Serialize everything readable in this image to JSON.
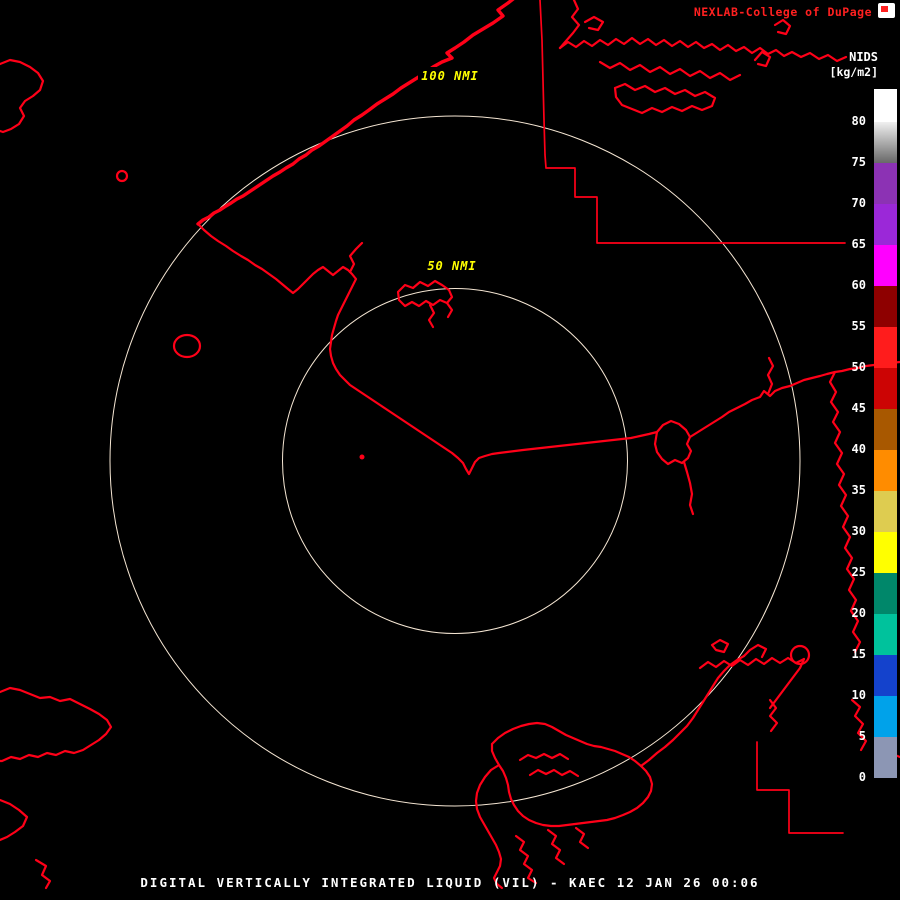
{
  "header": {
    "brand": "NEXLAB-College of DuPage"
  },
  "colors": {
    "background": "#000000",
    "brand": "#ff2020",
    "text": "#ffffff",
    "map_outline": "#ff0018",
    "range_ring": "#f6e7d4",
    "ring_label": "#ffff00"
  },
  "rings": [
    {
      "label": "100 NMI",
      "radius_nmi": 100
    },
    {
      "label": "50 NMI",
      "radius_nmi": 50
    }
  ],
  "colorbar": {
    "title": "NIDS",
    "units": "[kg/m2]",
    "ticks": [
      80,
      75,
      70,
      65,
      60,
      55,
      50,
      45,
      40,
      35,
      30,
      25,
      20,
      15,
      10,
      5,
      0
    ],
    "segments": [
      {
        "from": 80,
        "to": 84,
        "color": "#ffffff"
      },
      {
        "from": 75,
        "to": 80,
        "color": "#f0f0f0",
        "color2": "#686868"
      },
      {
        "from": 70,
        "to": 75,
        "color": "#8c32b4"
      },
      {
        "from": 65,
        "to": 70,
        "color": "#9b28d8"
      },
      {
        "from": 60,
        "to": 65,
        "color": "#ff00ff"
      },
      {
        "from": 55,
        "to": 60,
        "color": "#8e0000"
      },
      {
        "from": 50,
        "to": 55,
        "color": "#ff1c1c"
      },
      {
        "from": 45,
        "to": 50,
        "color": "#cc0404"
      },
      {
        "from": 40,
        "to": 45,
        "color": "#a85800"
      },
      {
        "from": 35,
        "to": 40,
        "color": "#ff8c00"
      },
      {
        "from": 30,
        "to": 35,
        "color": "#decc50"
      },
      {
        "from": 25,
        "to": 30,
        "color": "#ffff00"
      },
      {
        "from": 20,
        "to": 25,
        "color": "#00876a"
      },
      {
        "from": 15,
        "to": 20,
        "color": "#00c29c"
      },
      {
        "from": 10,
        "to": 15,
        "color": "#1442cc"
      },
      {
        "from": 5,
        "to": 10,
        "color": "#00a2ea"
      },
      {
        "from": 0,
        "to": 5,
        "color": "#8c96b4"
      }
    ]
  },
  "caption": {
    "text": "DIGITAL VERTICALLY INTEGRATED LIQUID (VIL) - KAEC 12 JAN 26 00:06"
  }
}
